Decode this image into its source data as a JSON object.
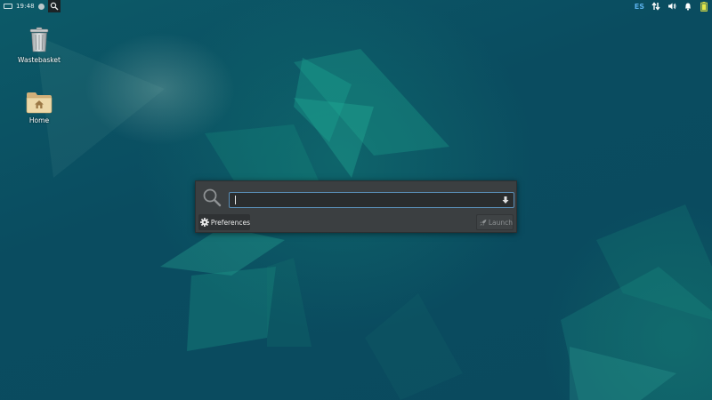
{
  "panel": {
    "clock": "19:48",
    "keyboard_layout": "ES",
    "icons": [
      "keyboard-icon",
      "status-dot-icon",
      "search-icon",
      "network-icon",
      "volume-icon",
      "notifications-icon",
      "battery-icon"
    ]
  },
  "desktop": {
    "icons": [
      {
        "label": "Wastebasket",
        "icon": "trash-icon"
      },
      {
        "label": "Home",
        "icon": "home-folder-icon"
      }
    ]
  },
  "appfinder": {
    "search_value": "",
    "preferences_label": "Preferences",
    "launch_label": "Launch",
    "accent_color": "#5a8fb8"
  },
  "colors": {
    "desktop_base": "#0b4f63",
    "dialog_bg": "#3b3f41",
    "lang_indicator": "#5ab0ea",
    "battery": "#e4e84a"
  }
}
